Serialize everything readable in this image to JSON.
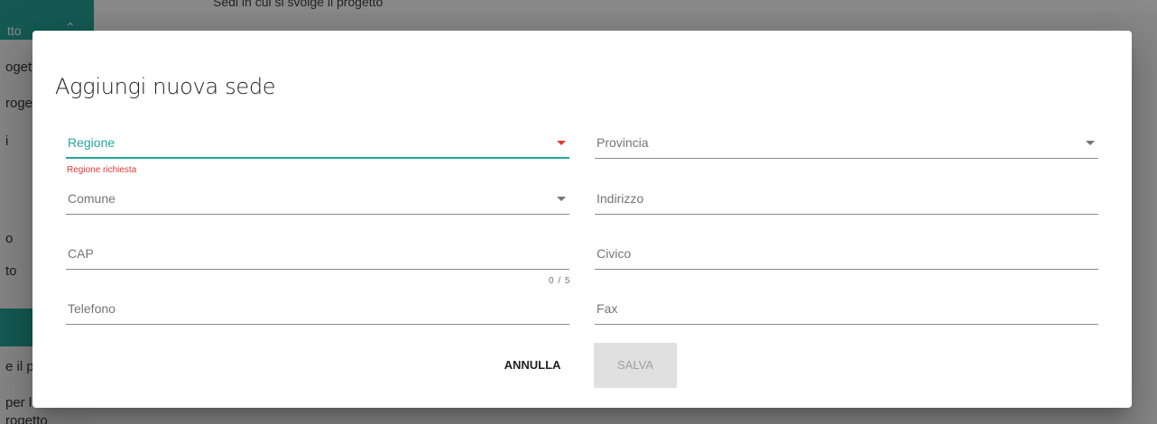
{
  "background": {
    "sidebar_header": "tto",
    "breadcrumb": "Sedi in cui si svolge il progetto",
    "sidebar_items": [
      "ogett",
      "roge",
      "i",
      "o",
      "to",
      "e il p",
      "per l",
      "rogetto"
    ]
  },
  "dialog": {
    "title": "Aggiungi nuova sede",
    "fields": {
      "regione": {
        "label": "Regione",
        "error": "Regione richiesta"
      },
      "provincia": {
        "label": "Provincia"
      },
      "comune": {
        "label": "Comune"
      },
      "indirizzo": {
        "label": "Indirizzo"
      },
      "cap": {
        "label": "CAP",
        "counter": "0 / 5"
      },
      "civico": {
        "label": "Civico"
      },
      "telefono": {
        "label": "Telefono"
      },
      "fax": {
        "label": "Fax"
      }
    },
    "buttons": {
      "cancel": "ANNULLA",
      "save": "SALVA"
    }
  },
  "colors": {
    "accent": "#26a69a",
    "error": "#e53935"
  },
  "icons": {
    "dropdown": "caret-down-icon",
    "chevron": "chevron-up-icon"
  }
}
